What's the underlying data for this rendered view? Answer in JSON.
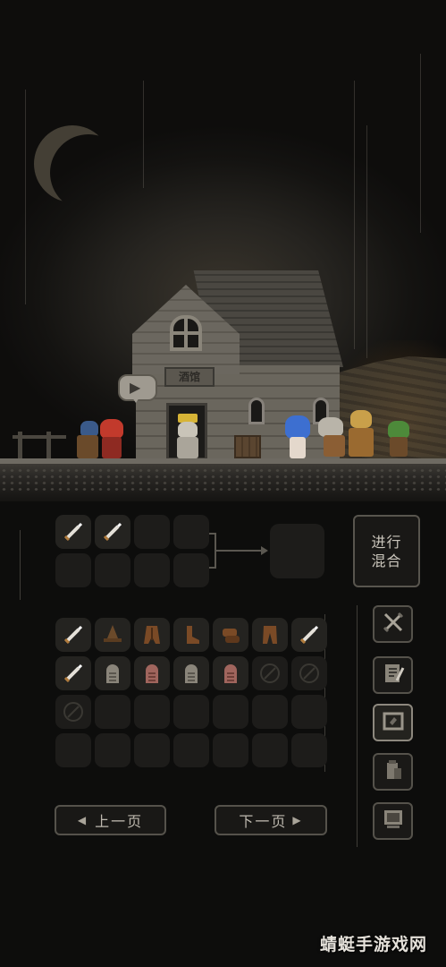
{
  "scene": {
    "house_sign": "酒馆",
    "speech_icon": "door-enter-icon"
  },
  "crafting": {
    "input_slots": [
      "sword",
      "sword",
      "",
      "",
      "",
      "",
      "",
      ""
    ],
    "mix_button_line1": "进行",
    "mix_button_line2": "混合"
  },
  "inventory": {
    "items": [
      "sword",
      "wizard-hat",
      "leather-cloak",
      "leather-boots",
      "leather-gloves",
      "leather-pants",
      "sword",
      "sword",
      "stone-tablet",
      "red-tablet",
      "stone-tablet",
      "red-tablet",
      "ring",
      "ring",
      "ring",
      "",
      "",
      "",
      "",
      "",
      "",
      "",
      "",
      "",
      "",
      "",
      "",
      ""
    ]
  },
  "side_menu": [
    {
      "icon": "crossed-swords-icon",
      "active": false
    },
    {
      "icon": "scroll-quill-icon",
      "active": false
    },
    {
      "icon": "cauldron-icon",
      "active": true
    },
    {
      "icon": "potion-bag-icon",
      "active": false
    },
    {
      "icon": "monitor-icon",
      "active": false
    }
  ],
  "pagination": {
    "prev_label": "上一页",
    "next_label": "下一页"
  },
  "watermark": "蜻蜓手游戏网",
  "colors": {
    "background": "#0d0d0c",
    "slot": "#1d1c1a",
    "border": "#55524b",
    "text": "#cbc6bc"
  }
}
